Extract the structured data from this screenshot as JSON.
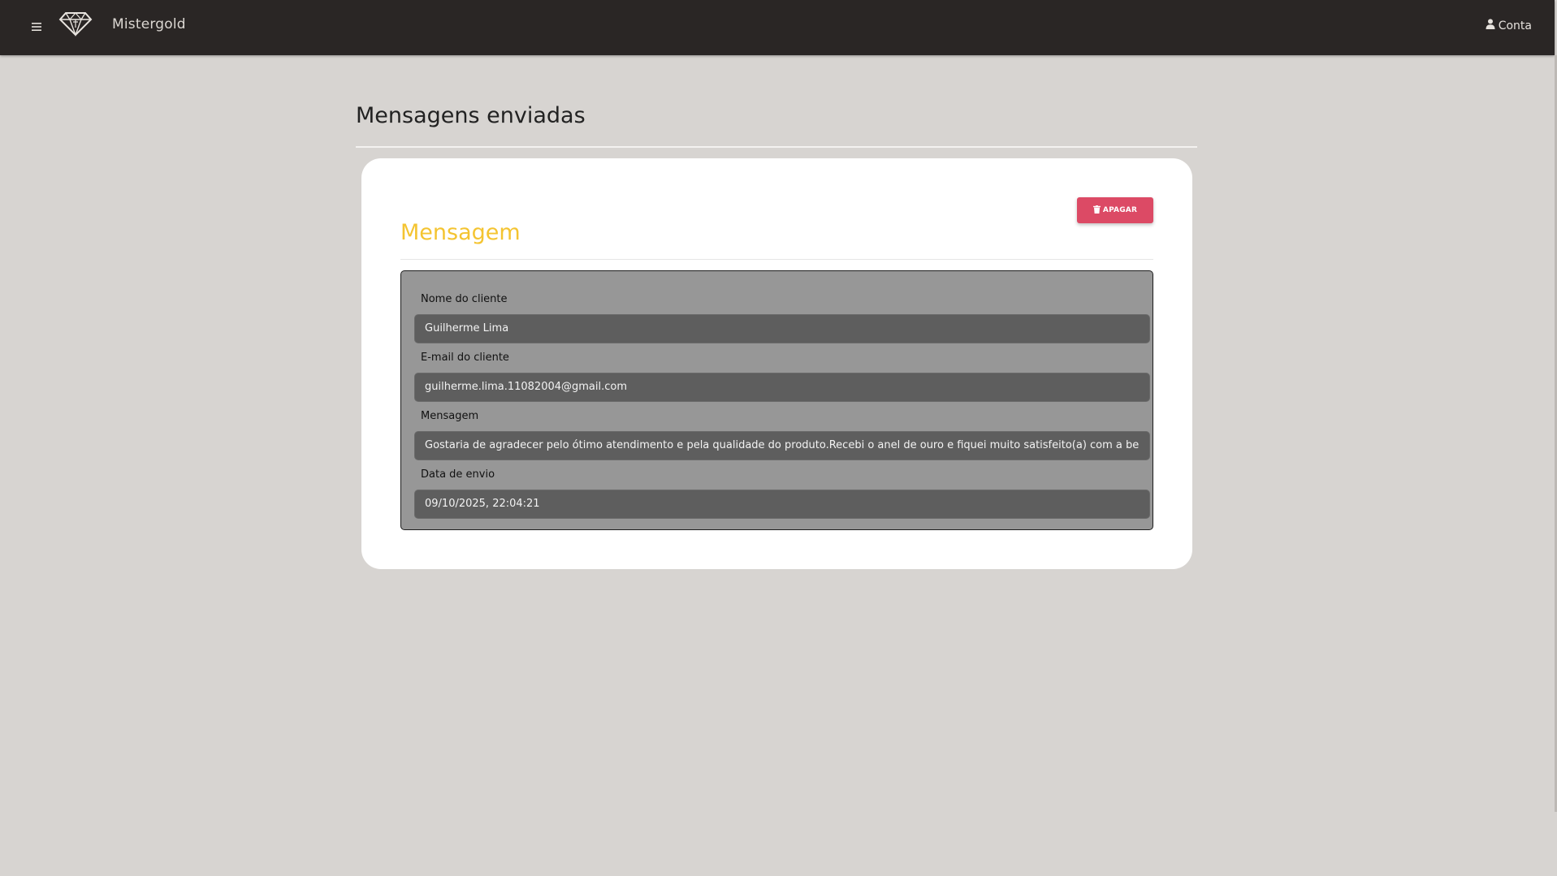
{
  "header": {
    "menu_icon": "hamburger-menu-icon",
    "logo_icon": "diamond-logo-icon",
    "brand": "Mistergold",
    "account_icon": "user-icon",
    "account_label": "Conta"
  },
  "page": {
    "title": "Mensagens enviadas"
  },
  "message_card": {
    "section_title": "Mensagem",
    "delete_button": {
      "icon": "trash-icon",
      "label": "APAGAR",
      "color": "#dc4a65"
    },
    "fields": [
      {
        "label": "Nome do cliente",
        "value": "Guilherme Lima"
      },
      {
        "label": "E-mail do cliente",
        "value": "guilherme.lima.11082004@gmail.com"
      },
      {
        "label": "Mensagem",
        "value": "Gostaria de agradecer pelo ótimo atendimento e pela qualidade do produto.Recebi o anel de ouro e fiquei muito satisfeito(a) com a be"
      },
      {
        "label": "Data de envio",
        "value": "09/10/2025, 22:04:21"
      }
    ]
  },
  "colors": {
    "header_bg": "#2a2625",
    "page_bg": "#d7d4d1",
    "section_title": "#f4c431",
    "form_bg": "#979797",
    "field_bg": "#5e5e5e"
  }
}
